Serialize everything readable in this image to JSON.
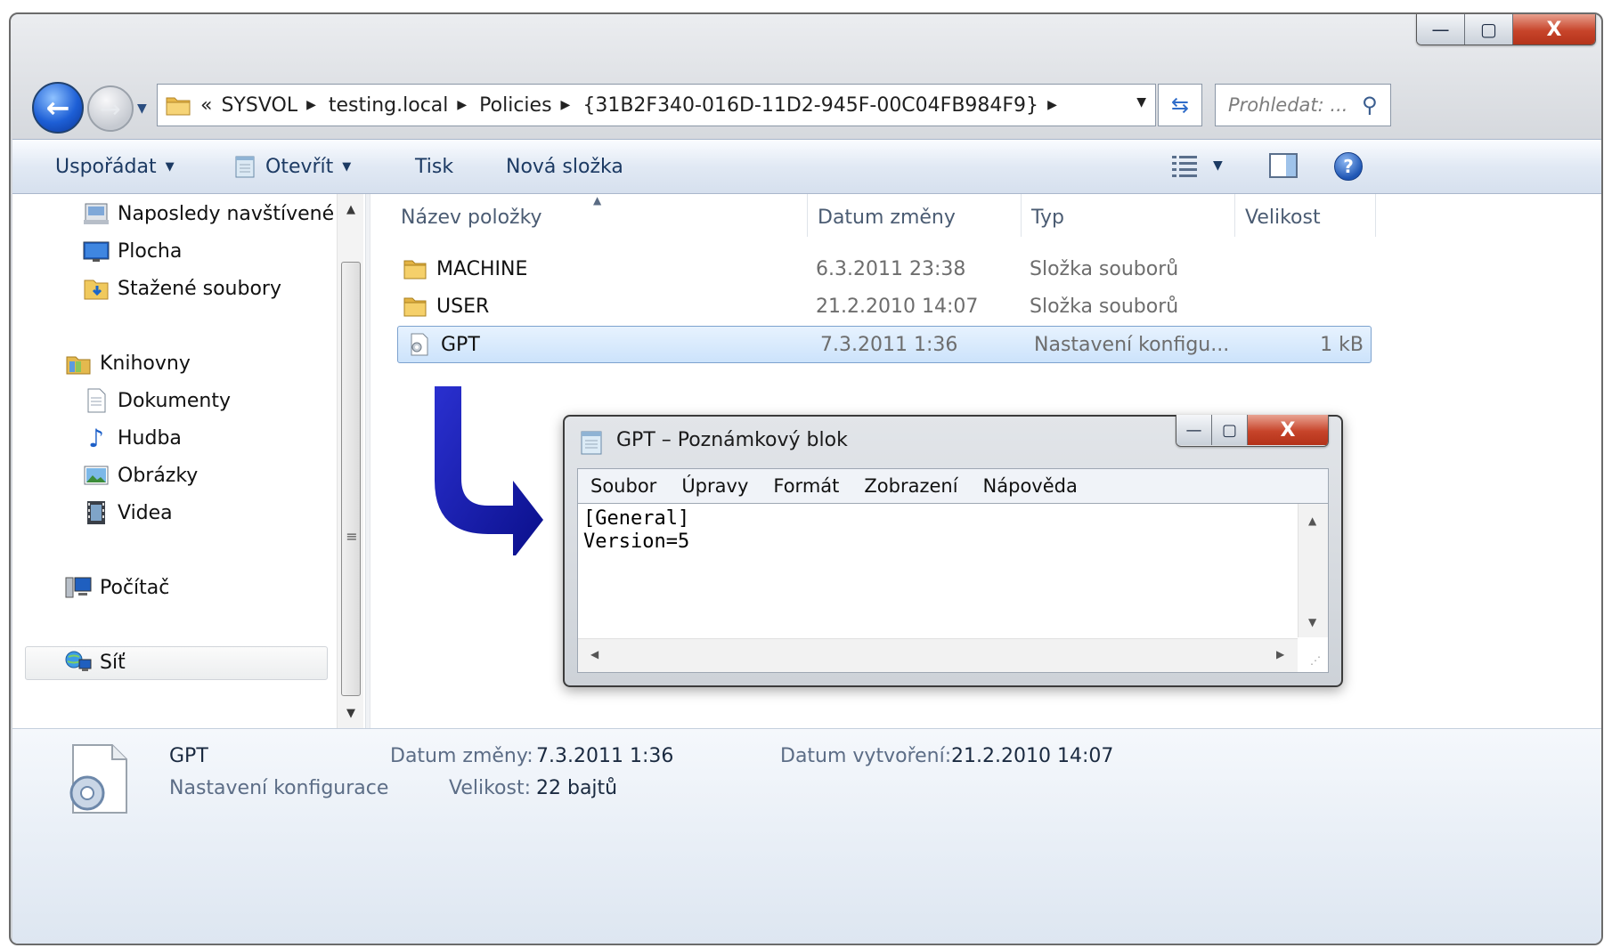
{
  "window": {
    "minimize": "—",
    "maximize": "▢",
    "close": "X"
  },
  "address": {
    "overflow": "«",
    "crumbs": [
      "SYSVOL",
      "testing.local",
      "Policies",
      "{31B2F340-016D-11D2-945F-00C04FB984F9}"
    ],
    "separator": "▶",
    "dropdown": "▼"
  },
  "search": {
    "placeholder": "Prohledat: ..."
  },
  "toolbar": {
    "organize": "Uspořádat",
    "open": "Otevřít",
    "print": "Tisk",
    "new_folder": "Nová složka",
    "help": "?"
  },
  "nav": {
    "items": [
      {
        "label": "Naposledy navštívené",
        "icon": "recent-places-icon"
      },
      {
        "label": "Plocha",
        "icon": "desktop-icon"
      },
      {
        "label": "Stažené soubory",
        "icon": "downloads-folder-icon"
      },
      {
        "label": "Knihovny",
        "icon": "libraries-icon"
      },
      {
        "label": "Dokumenty",
        "icon": "documents-icon"
      },
      {
        "label": "Hudba",
        "icon": "music-icon"
      },
      {
        "label": "Obrázky",
        "icon": "pictures-icon"
      },
      {
        "label": "Videa",
        "icon": "videos-icon"
      },
      {
        "label": "Počítač",
        "icon": "computer-icon"
      },
      {
        "label": "Síť",
        "icon": "network-icon"
      }
    ]
  },
  "columns": {
    "name": "Název položky",
    "date": "Datum změny",
    "type": "Typ",
    "size": "Velikost"
  },
  "files": [
    {
      "name": "MACHINE",
      "date": "6.3.2011 23:38",
      "type": "Složka souborů",
      "size": "",
      "icon": "folder-icon"
    },
    {
      "name": "USER",
      "date": "21.2.2010 14:07",
      "type": "Složka souborů",
      "size": "",
      "icon": "folder-icon"
    },
    {
      "name": "GPT",
      "date": "7.3.2011 1:36",
      "type": "Nastavení konfigu...",
      "size": "1 kB",
      "icon": "config-file-icon",
      "selected": true
    }
  ],
  "notepad": {
    "title": "GPT – Poznámkový blok",
    "menu": [
      "Soubor",
      "Úpravy",
      "Formát",
      "Zobrazení",
      "Nápověda"
    ],
    "lines": [
      "[General]",
      "Version=5"
    ]
  },
  "details": {
    "name": "GPT",
    "type": "Nastavení konfigurace",
    "modified_label": "Datum změny:",
    "modified_value": "7.3.2011 1:36",
    "size_label": "Velikost:",
    "size_value": "22 bajtů",
    "created_label": "Datum vytvoření:",
    "created_value": "21.2.2010 14:07"
  },
  "colors": {
    "accent": "#1f56b4",
    "arrow": "#1a1fb0",
    "close_button": "#c7442a",
    "selection": "#cce3fb"
  }
}
